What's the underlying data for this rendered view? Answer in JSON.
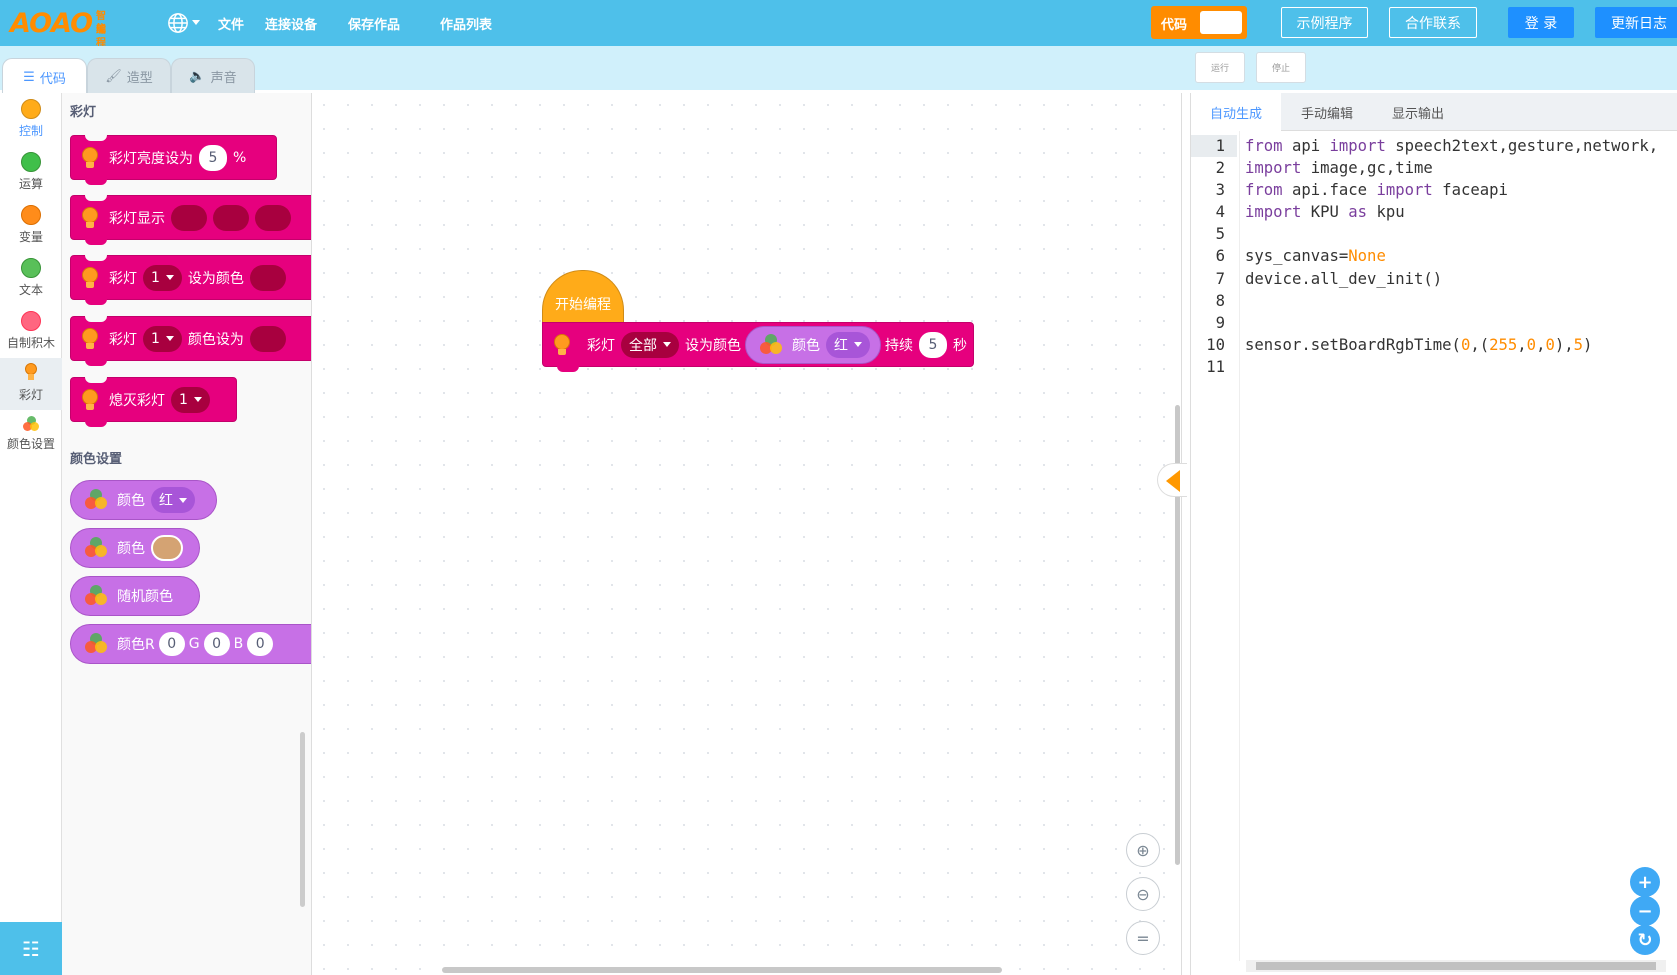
{
  "topbar": {
    "logo": "AOAO",
    "logo_sub": [
      "智能",
      "编程"
    ],
    "menu": [
      "文件",
      "连接设备",
      "保存作品",
      "作品列表"
    ],
    "code_toggle_label": "代码",
    "buttons": [
      "示例程序",
      "合作联系",
      "登 录",
      "更新日志"
    ]
  },
  "tabs": [
    {
      "label": "代码",
      "icon": "code-blocks-icon"
    },
    {
      "label": "造型",
      "icon": "brush-icon"
    },
    {
      "label": "声音",
      "icon": "speaker-icon"
    }
  ],
  "run_controls": [
    "运行",
    "停止"
  ],
  "categories": [
    {
      "label": "控制",
      "color": "#ffab19"
    },
    {
      "label": "运算",
      "color": "#40bf4a"
    },
    {
      "label": "变量",
      "color": "#ff8c1a"
    },
    {
      "label": "文本",
      "color": "#59c059"
    },
    {
      "label": "自制积木",
      "color": "#ff6680"
    },
    {
      "label": "彩灯",
      "color": "#ff9a1f",
      "icon": "bulb-icon"
    },
    {
      "label": "颜色设置",
      "color": "#c770e6",
      "icon": "rgb-icon"
    }
  ],
  "palette": {
    "section1": "彩灯",
    "blocks": [
      {
        "text": "彩灯亮度设为",
        "value": "5",
        "suffix": "%"
      },
      {
        "text": "彩灯显示"
      },
      {
        "text": "彩灯",
        "dropdown": "1",
        "text2": "设为颜色"
      },
      {
        "text": "彩灯",
        "dropdown": "1",
        "text2": "颜色设为"
      },
      {
        "text": "熄灭彩灯",
        "dropdown": "1"
      }
    ],
    "section2": "颜色设置",
    "color_blocks": [
      {
        "text": "颜色",
        "dropdown": "红"
      },
      {
        "text": "颜色",
        "swatch": "#d4a373"
      },
      {
        "text": "随机颜色"
      },
      {
        "text": "颜色R",
        "r": "0",
        "g_label": "G",
        "g": "0",
        "b_label": "B",
        "b": "0"
      }
    ]
  },
  "workspace": {
    "hat": "开始编程",
    "block": {
      "text": "彩灯",
      "target": "全部",
      "text2": "设为颜色",
      "color_text": "颜色",
      "color_value": "红",
      "text3": "持续",
      "duration": "5",
      "unit": "秒"
    }
  },
  "code_tabs": [
    "自动生成",
    "手动编辑",
    "显示输出"
  ],
  "code_lines": [
    {
      "n": "1",
      "parts": [
        [
          "kw",
          "from"
        ],
        [
          "t",
          " api "
        ],
        [
          "kw",
          "import"
        ],
        [
          "t",
          " speech2text,gesture,network,"
        ]
      ]
    },
    {
      "n": "2",
      "parts": [
        [
          "kw",
          "import"
        ],
        [
          "t",
          " image,gc,time"
        ]
      ]
    },
    {
      "n": "3",
      "parts": [
        [
          "kw",
          "from"
        ],
        [
          "t",
          " api.face "
        ],
        [
          "kw",
          "import"
        ],
        [
          "t",
          " faceapi"
        ]
      ]
    },
    {
      "n": "4",
      "parts": [
        [
          "kw",
          "import"
        ],
        [
          "t",
          " KPU "
        ],
        [
          "kw",
          "as"
        ],
        [
          "t",
          " kpu"
        ]
      ]
    },
    {
      "n": "5",
      "parts": []
    },
    {
      "n": "6",
      "parts": [
        [
          "t",
          "sys_canvas="
        ],
        [
          "num",
          "None"
        ]
      ]
    },
    {
      "n": "7",
      "parts": [
        [
          "t",
          "device.all_dev_init()"
        ]
      ]
    },
    {
      "n": "8",
      "parts": []
    },
    {
      "n": "9",
      "parts": []
    },
    {
      "n": "10",
      "parts": [
        [
          "t",
          "sensor.setBoardRgbTime("
        ],
        [
          "num",
          "0"
        ],
        [
          "t",
          ",("
        ],
        [
          "num",
          "255"
        ],
        [
          "t",
          ","
        ],
        [
          "num",
          "0"
        ],
        [
          "t",
          ","
        ],
        [
          "num",
          "0"
        ],
        [
          "t",
          "),"
        ],
        [
          "num",
          "5"
        ],
        [
          "t",
          ")"
        ]
      ]
    },
    {
      "n": "11",
      "parts": []
    }
  ]
}
